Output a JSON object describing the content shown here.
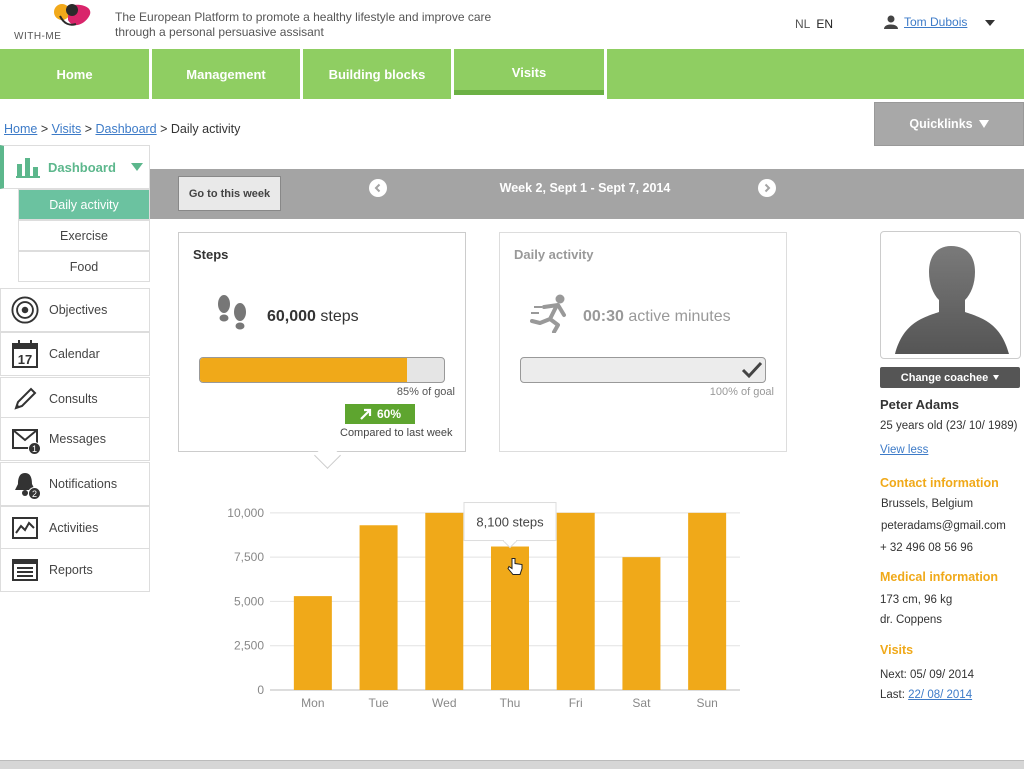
{
  "header": {
    "logo_text": "WITH-ME",
    "tagline_line1": "The European Platform to promote a healthy lifestyle and improve care",
    "tagline_line2": "through a personal persuasive assisant",
    "lang_nl": "NL",
    "lang_en": "EN",
    "user_name": "Tom Dubois"
  },
  "nav": {
    "tabs": [
      {
        "label": "Home"
      },
      {
        "label": "Management"
      },
      {
        "label": "Building blocks"
      },
      {
        "label": "Visits"
      }
    ]
  },
  "breadcrumb": {
    "home": "Home",
    "visits": "Visits",
    "dashboard": "Dashboard",
    "current": "Daily activity"
  },
  "quicklinks": {
    "label": "Quicklinks"
  },
  "sidebar": {
    "dashboard": "Dashboard",
    "sub": [
      "Daily activity",
      "Exercise",
      "Food"
    ],
    "items": [
      {
        "label": "Objectives"
      },
      {
        "label": "Calendar",
        "icon_text": "17"
      },
      {
        "label": "Consults"
      },
      {
        "label": "Messages",
        "badge": "1"
      },
      {
        "label": "Notifications",
        "badge": "2"
      },
      {
        "label": "Activities"
      },
      {
        "label": "Reports"
      }
    ]
  },
  "week": {
    "go_label": "Go to this week",
    "label": "Week 2, Sept 1 - Sept 7, 2014"
  },
  "steps_card": {
    "title": "Steps",
    "value": "60,000",
    "unit": "steps",
    "goal_text": "85% of goal",
    "goal_fraction": 0.85,
    "compare_value": "60%",
    "compare_text": "Compared to last week"
  },
  "activity_card": {
    "title": "Daily activity",
    "value": "00:30",
    "unit": "active minutes",
    "goal_text": "100% of goal",
    "goal_fraction": 1.0
  },
  "chart_data": {
    "type": "bar",
    "categories": [
      "Mon",
      "Tue",
      "Wed",
      "Thu",
      "Fri",
      "Sat",
      "Sun"
    ],
    "values": [
      5300,
      9300,
      10000,
      8100,
      10000,
      7500,
      10000
    ],
    "yticks": [
      "0",
      "2,500",
      "5,000",
      "7,500",
      "10,000"
    ],
    "ylim": [
      0,
      10500
    ],
    "tooltip": {
      "category": "Thu",
      "label": "8,100 steps"
    },
    "bar_color": "#f0a919",
    "grid": true
  },
  "profile": {
    "change_coachee": "Change coachee",
    "name": "Peter Adams",
    "age": "25 years old (23/ 10/ 1989)",
    "view_less": "View less",
    "contact_heading": "Contact information",
    "city": "Brussels, Belgium",
    "email": "peteradams@gmail.com",
    "phone": "+ 32 496 08 56 96",
    "medical_heading": "Medical information",
    "body": "173 cm, 96 kg",
    "doctor": "dr. Coppens",
    "visits_heading": "Visits",
    "next_label": "Next: 05/ 09/ 2014",
    "last_label": "Last:",
    "last_date": "22/ 08/ 2014"
  },
  "colors": {
    "nav_green": "#8fce62",
    "dashboard_teal": "#5cb78c",
    "accent_orange": "#f0a919",
    "link_blue": "#3d7bc8",
    "compare_green": "#5ea52f"
  }
}
